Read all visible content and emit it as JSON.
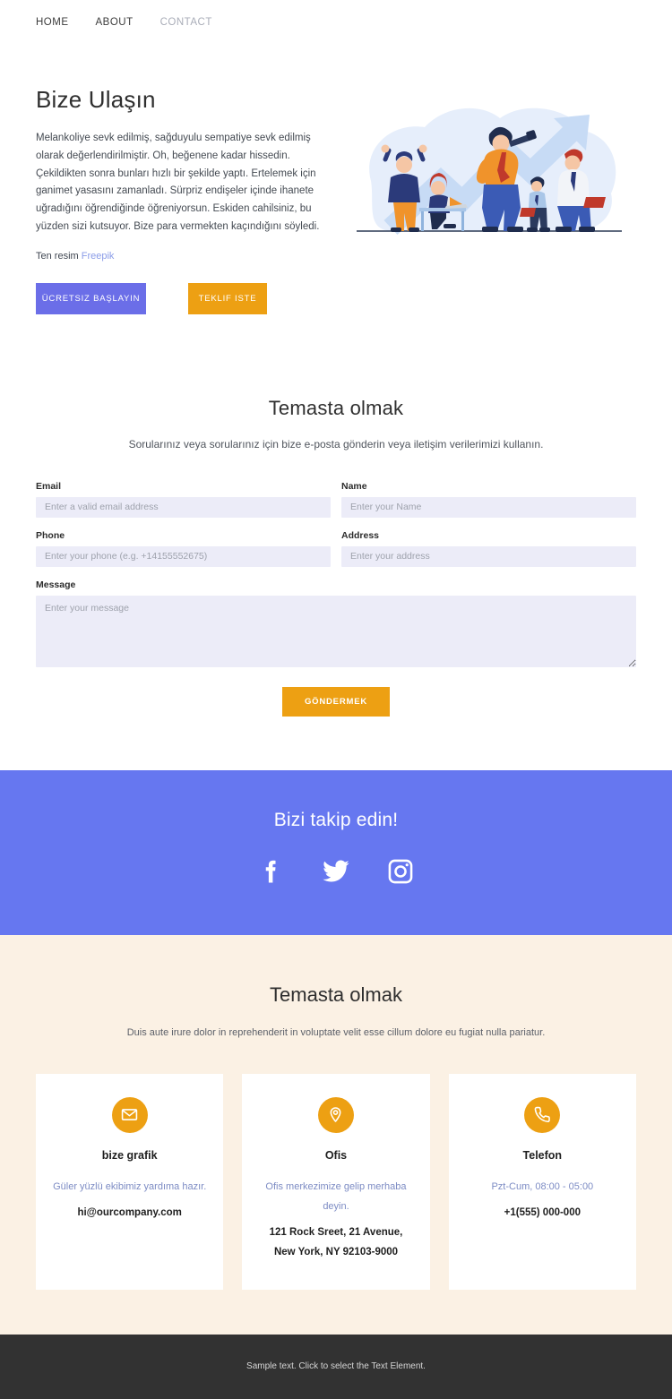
{
  "nav": {
    "items": [
      {
        "label": "HOME",
        "active": true
      },
      {
        "label": "ABOUT",
        "active": true
      },
      {
        "label": "CONTACT",
        "active": false
      }
    ]
  },
  "hero": {
    "title": "Bize Ulaşın",
    "paragraph": "Melankoliye sevk edilmiş, sağduyulu sempatiye sevk edilmiş olarak değerlendirilmiştir. Oh, beğenene kadar hissedin. Çekildikten sonra bunları hızlı bir şekilde yaptı. Ertelemek için ganimet yasasını zamanladı. Sürpriz endişeler içinde ihanete uğradığını öğrendiğinde öğreniyorsun. Eskiden cahilsiniz, bu yüzden sizi kutsuyor. Bize para vermekten kaçındığını söyledi.",
    "credit_prefix": "Ten resim",
    "credit_link": "Freepik",
    "primary_button": "ÜCRETSIZ BAŞLAYIN",
    "secondary_button": "TEKLIF ISTE",
    "illustration_alt": "business-team-growth-illustration"
  },
  "contact": {
    "title": "Temasta olmak",
    "subtitle": "Sorularınız veya sorularınız için bize e-posta gönderin veya iletişim verilerimizi kullanın.",
    "fields": {
      "email": {
        "label": "Email",
        "placeholder": "Enter a valid email address",
        "value": ""
      },
      "name": {
        "label": "Name",
        "placeholder": "Enter your Name",
        "value": ""
      },
      "phone": {
        "label": "Phone",
        "placeholder": "Enter your phone (e.g. +14155552675)",
        "value": ""
      },
      "address": {
        "label": "Address",
        "placeholder": "Enter your address",
        "value": ""
      },
      "message": {
        "label": "Message",
        "placeholder": "Enter your message",
        "value": ""
      }
    },
    "submit_label": "GÖNDERMEK"
  },
  "social": {
    "title": "Bizi takip edin!",
    "items": [
      {
        "name": "facebook-icon",
        "label": "Facebook"
      },
      {
        "name": "twitter-icon",
        "label": "Twitter"
      },
      {
        "name": "instagram-icon",
        "label": "Instagram"
      }
    ]
  },
  "cards_section": {
    "title": "Temasta olmak",
    "subtitle": "Duis aute irure dolor in reprehenderit in voluptate velit esse cillum dolore eu fugiat nulla pariatur.",
    "cards": [
      {
        "icon": "envelope-icon",
        "title": "bize grafik",
        "description": "Güler yüzlü ekibimiz yardıma hazır.",
        "value_lines": [
          "hi@ourcompany.com"
        ]
      },
      {
        "icon": "map-pin-icon",
        "title": "Ofis",
        "description": "Ofis merkezimize gelip merhaba deyin.",
        "value_lines": [
          "121 Rock Sreet, 21 Avenue,",
          "New York, NY 92103-9000"
        ]
      },
      {
        "icon": "phone-icon",
        "title": "Telefon",
        "description": "Pzt-Cum, 08:00 - 05:00",
        "value_lines": [
          "+1(555) 000-000"
        ]
      }
    ]
  },
  "footer": {
    "text": "Sample text. Click to select the Text Element."
  },
  "colors": {
    "purple": "#6677f0",
    "purple_button": "#6b6ee8",
    "orange": "#eda013",
    "beige": "#fbf1e4",
    "footer_dark": "#323232",
    "input_bg": "#ececf8",
    "link_blue": "#8a9ce8",
    "card_desc": "#7d8cc4"
  }
}
